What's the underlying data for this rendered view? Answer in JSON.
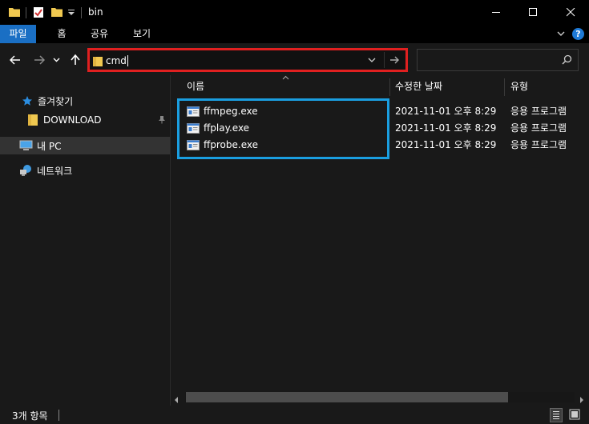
{
  "window": {
    "title": "bin",
    "minimize_glyph": "—",
    "maximize_glyph": "☐",
    "close_glyph": "✕"
  },
  "ribbon": {
    "tabs": [
      {
        "label": "파일",
        "active": true
      },
      {
        "label": "홈"
      },
      {
        "label": "공유"
      },
      {
        "label": "보기"
      }
    ],
    "help_label": "?"
  },
  "address": {
    "value": "cmd"
  },
  "search": {
    "placeholder": ""
  },
  "nav_pane": {
    "quick_access": "즐겨찾기",
    "pinned_folder": "DOWNLOAD",
    "this_pc": "내 PC",
    "network": "네트워크"
  },
  "columns": {
    "name": "이름",
    "modified": "수정한 날짜",
    "type": "유형"
  },
  "files": [
    {
      "name": "ffmpeg.exe",
      "modified": "2021-11-01 오후 8:29",
      "type": "응용 프로그램"
    },
    {
      "name": "ffplay.exe",
      "modified": "2021-11-01 오후 8:29",
      "type": "응용 프로그램"
    },
    {
      "name": "ffprobe.exe",
      "modified": "2021-11-01 오후 8:29",
      "type": "응용 프로그램"
    }
  ],
  "status": {
    "item_count": "3개 항목"
  },
  "colors": {
    "accent": "#1a6fc4",
    "address_highlight": "#e02020",
    "files_highlight": "#1a9ee0",
    "folder_yellow": "#f0c850"
  }
}
